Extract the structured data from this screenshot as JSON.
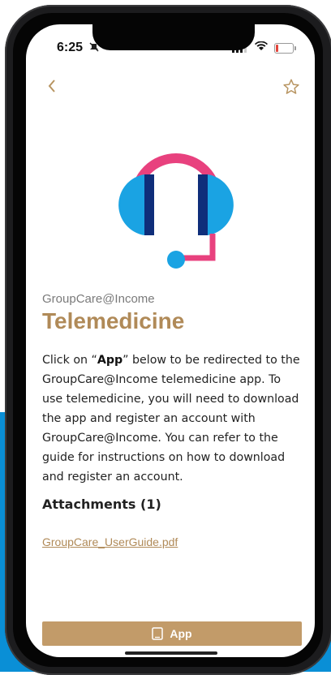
{
  "status_bar": {
    "time": "6:25",
    "icons": [
      "mute-icon",
      "signal-icon",
      "wifi-icon",
      "battery-icon"
    ],
    "battery_level_percent": 15
  },
  "nav": {
    "back_icon": "chevron-left-icon",
    "favorite_icon": "star-outline-icon"
  },
  "hero_icon": "headset-icon",
  "header": {
    "eyebrow": "GroupCare@Income",
    "title": "Telemedicine"
  },
  "description": {
    "part1": "Click on “",
    "bold": "App",
    "part2": "” below to be redirected to the GroupCare@Income telemedicine app. To use telemedicine, you will need to download the app and register an account with GroupCare@Income. You can refer to the guide for instructions on how to download and register an account."
  },
  "attachments": {
    "heading": "Attachments (1)",
    "items": [
      "GroupCare_UserGuide.pdf"
    ]
  },
  "cta": {
    "label": "App",
    "icon": "tablet-icon"
  },
  "colors": {
    "accent": "#b08a58",
    "button": "#c29b69",
    "headset_pink": "#e8417e",
    "headset_blue": "#1aa3e3",
    "headset_navy": "#0f2e7a",
    "background_blue": "#0a8fd6"
  }
}
